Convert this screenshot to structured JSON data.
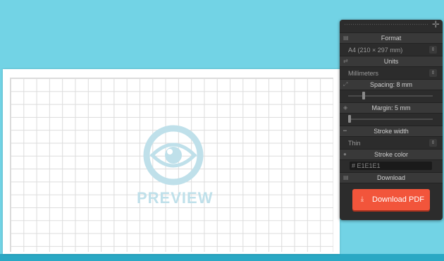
{
  "preview": {
    "label": "PREVIEW"
  },
  "panel": {
    "format": {
      "header": "Format",
      "value": "A4 (210 × 297 mm)"
    },
    "units": {
      "header": "Units",
      "value": "Millimeters"
    },
    "spacing": {
      "header": "Spacing: 8 mm",
      "level": 0.17
    },
    "margin": {
      "header": "Margin: 5 mm",
      "level": 0.0
    },
    "stroke_width": {
      "header": "Stroke width",
      "value": "Thin"
    },
    "stroke_color": {
      "header": "Stroke color",
      "hash": "#",
      "value": "E1E1E1"
    },
    "download": {
      "header": "Download",
      "button_label": "Download PDF"
    }
  },
  "colors": {
    "background": "#72d3e5",
    "panel": "#2c2c2c",
    "accent_button": "#f2553b",
    "grid_line": "#e1e1e1"
  },
  "icons": [
    "drag-handle",
    "plus-icon",
    "file-icon",
    "swap-icon",
    "expand-icon",
    "margin-icon",
    "stroke-icon",
    "droplet-icon",
    "download-icon",
    "eye-icon"
  ]
}
